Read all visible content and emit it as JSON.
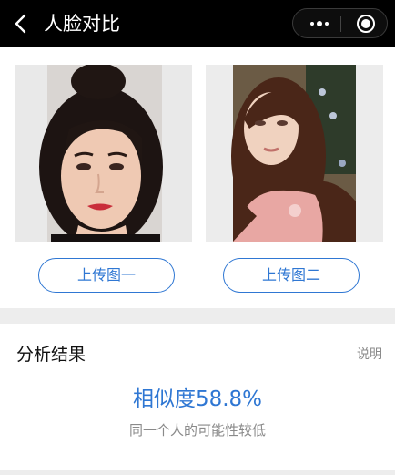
{
  "header": {
    "title": "人脸对比",
    "back_icon": "chevron-left-icon",
    "more_icon": "more-dots-icon",
    "close_icon": "target-circle-icon"
  },
  "photos": [
    {
      "upload_label": "上传图一"
    },
    {
      "upload_label": "上传图二"
    }
  ],
  "result": {
    "section_title": "分析结果",
    "explain_label": "说明",
    "similarity_text": "相似度58.8%",
    "similarity_value": 58.8,
    "verdict": "同一个人的可能性较低"
  },
  "colors": {
    "accent": "#2f77d3",
    "header_bg": "#000000",
    "page_bg": "#ededed",
    "muted_text": "#8a8a8a"
  }
}
